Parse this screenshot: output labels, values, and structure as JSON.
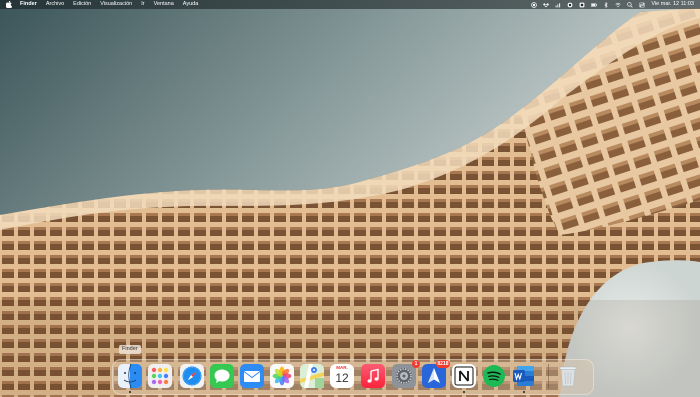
{
  "menubar": {
    "items": [
      {
        "label": "Finder",
        "bold": true
      },
      {
        "label": "Archivo"
      },
      {
        "label": "Edición"
      },
      {
        "label": "Visualización"
      },
      {
        "label": "Ir"
      },
      {
        "label": "Ventana"
      },
      {
        "label": "Ayuda"
      }
    ],
    "clock": "Vie mar. 12  11:03",
    "status_icons": [
      "record-icon",
      "dropbox-icon",
      "wifi-bars-icon",
      "search-cloud-icon",
      "app-icon",
      "battery-icon",
      "bluetooth-icon",
      "wifi-icon",
      "search-icon",
      "control-center-icon"
    ]
  },
  "dock": {
    "tooltip": "Finder",
    "apps": [
      {
        "name": "Finder",
        "icon": "finder-icon"
      },
      {
        "name": "Launchpad",
        "icon": "launchpad-icon"
      },
      {
        "name": "Safari",
        "icon": "safari-icon"
      },
      {
        "name": "Messages",
        "icon": "messages-icon"
      },
      {
        "name": "Mail",
        "icon": "mail-icon"
      },
      {
        "name": "Photos",
        "icon": "photos-icon"
      },
      {
        "name": "Maps",
        "icon": "maps-icon"
      },
      {
        "name": "Calendar",
        "icon": "calendar-icon",
        "month": "MAR.",
        "day": "12"
      },
      {
        "name": "Music",
        "icon": "music-icon"
      },
      {
        "name": "System Preferences",
        "icon": "settings-icon",
        "badge": "1"
      },
      {
        "name": "Spark",
        "icon": "spark-icon",
        "badge": "8218"
      },
      {
        "name": "Notion",
        "icon": "notion-icon"
      },
      {
        "name": "Spotify",
        "icon": "spotify-icon"
      },
      {
        "name": "Word",
        "icon": "word-icon"
      },
      {
        "name": "Trash",
        "icon": "trash-icon"
      }
    ]
  },
  "colors": {
    "menubar_bg": "#1c2426",
    "wall_sky_top": "#3c5558",
    "wall_sky_light": "#c9d3d2",
    "wood": "#e7c6a0",
    "wood_shadow": "#6d4a2e"
  }
}
